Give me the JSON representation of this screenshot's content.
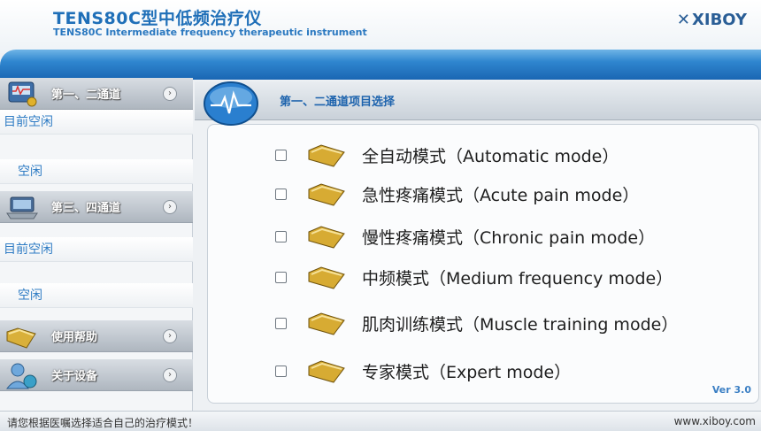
{
  "header": {
    "title": "TENS80C型中低频治疗仪",
    "subtitle": "TENS80C Intermediate frequency therapeutic instrument",
    "brand": "XIBOY",
    "brand_mark": "✕"
  },
  "sidebar": {
    "sections": [
      {
        "label": "第一、二通道",
        "status_lines": [
          "目前空闲",
          "空闲"
        ]
      },
      {
        "label": "第三、四通道",
        "status_lines": [
          "目前空闲",
          "空闲"
        ]
      },
      {
        "label": "使用帮助"
      },
      {
        "label": "关于设备"
      }
    ]
  },
  "main": {
    "title": "第一、二通道项目选择",
    "modes": [
      {
        "label": "全自动模式（Automatic mode）",
        "checked": false
      },
      {
        "label": "急性疼痛模式（Acute pain mode）",
        "checked": false
      },
      {
        "label": "慢性疼痛模式（Chronic pain mode）",
        "checked": false
      },
      {
        "label": "中频模式（Medium frequency mode）",
        "checked": false
      },
      {
        "label": "肌肉训练模式（Muscle training mode）",
        "checked": false
      },
      {
        "label": "专家模式（Expert mode）",
        "checked": false
      }
    ],
    "version": "Ver 3.0"
  },
  "footer": {
    "hint": "请您根据医嘱选择适合自己的治疗模式！",
    "url": "www.xiboy.com"
  },
  "colors": {
    "accent_blue": "#1f6fb8",
    "band_blue": "#2f86cf",
    "sidebar_status": "#2f7cc4"
  }
}
